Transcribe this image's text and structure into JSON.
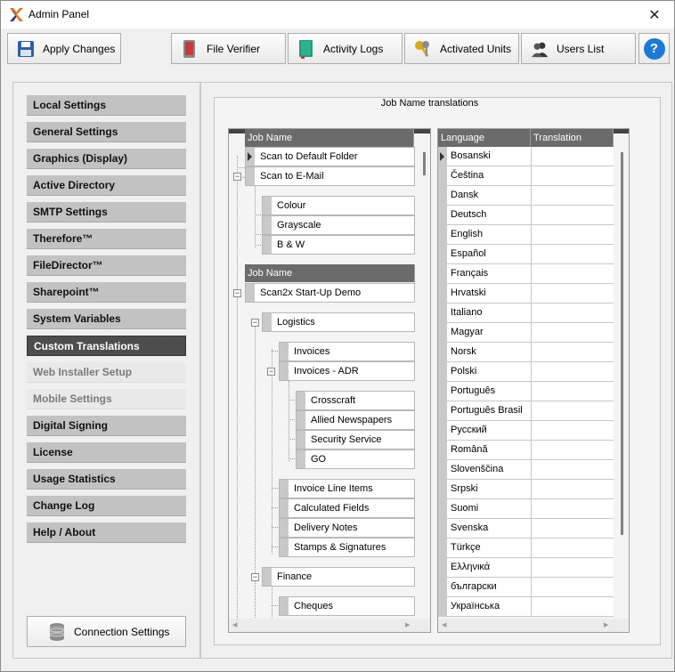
{
  "window": {
    "title": "Admin Panel"
  },
  "toolbar": {
    "apply_label": "Apply Changes",
    "file_verifier_label": "File Verifier",
    "activity_logs_label": "Activity Logs",
    "activated_units_label": "Activated Units",
    "users_list_label": "Users List",
    "help_label": "?"
  },
  "sidebar": {
    "items": [
      {
        "label": "Local Settings",
        "state": "normal"
      },
      {
        "label": "General Settings",
        "state": "normal"
      },
      {
        "label": "Graphics (Display)",
        "state": "normal"
      },
      {
        "label": "Active Directory",
        "state": "normal"
      },
      {
        "label": "SMTP Settings",
        "state": "normal"
      },
      {
        "label": "Therefore™",
        "state": "normal"
      },
      {
        "label": "FileDirector™",
        "state": "normal"
      },
      {
        "label": "Sharepoint™",
        "state": "normal"
      },
      {
        "label": "System Variables",
        "state": "normal"
      },
      {
        "label": "Custom Translations",
        "state": "active"
      },
      {
        "label": "Web Installer Setup",
        "state": "disabled"
      },
      {
        "label": "Mobile Settings",
        "state": "disabled"
      },
      {
        "label": "Digital Signing",
        "state": "normal"
      },
      {
        "label": "License",
        "state": "normal"
      },
      {
        "label": "Usage Statistics",
        "state": "normal"
      },
      {
        "label": "Change Log",
        "state": "normal"
      },
      {
        "label": "Help / About",
        "state": "normal"
      }
    ],
    "connection_label": "Connection Settings"
  },
  "main": {
    "group_title": "Job Name translations",
    "tree": {
      "header1": "Job Name",
      "header2": "Job Name",
      "rows": [
        {
          "label": "Scan to Default Folder"
        },
        {
          "label": "Scan to E-Mail"
        },
        {
          "label": "Colour"
        },
        {
          "label": "Grayscale"
        },
        {
          "label": "B & W"
        },
        {
          "label": "Scan2x Start-Up Demo"
        },
        {
          "label": "Logistics"
        },
        {
          "label": "Invoices"
        },
        {
          "label": "Invoices - ADR"
        },
        {
          "label": "Crosscraft"
        },
        {
          "label": "Allied Newspapers"
        },
        {
          "label": "Security Service"
        },
        {
          "label": "GO"
        },
        {
          "label": "Invoice Line Items"
        },
        {
          "label": "Calculated Fields"
        },
        {
          "label": "Delivery Notes"
        },
        {
          "label": "Stamps & Signatures"
        },
        {
          "label": "Finance"
        },
        {
          "label": "Cheques"
        }
      ]
    },
    "translations": {
      "col_language": "Language",
      "col_translation": "Translation",
      "languages": [
        "Bosanski",
        "Čeština",
        "Dansk",
        "Deutsch",
        "English",
        "Español",
        "Français",
        "Hrvatski",
        "Italiano",
        "Magyar",
        "Norsk",
        "Polski",
        "Português",
        "Português Brasil",
        "Русский",
        "Română",
        "Slovenščina",
        "Srpski",
        "Suomi",
        "Svenska",
        "Türkçe",
        "Ελληνικά",
        "български",
        "Українська"
      ]
    }
  },
  "colors": {
    "header_bg": "#6b6b6b",
    "nav_active_bg": "#4d4d4d",
    "nav_bg": "#c2c2c2",
    "help_blue": "#1c7ad6"
  }
}
